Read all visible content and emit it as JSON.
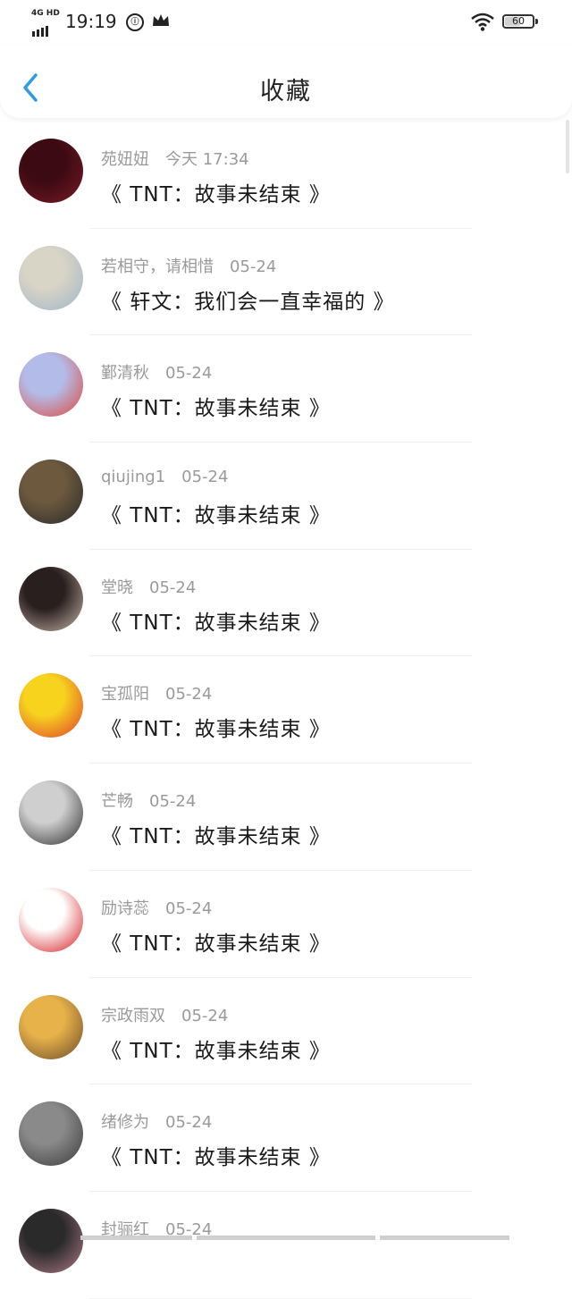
{
  "status_bar": {
    "network": "4G HD",
    "time": "19:19",
    "battery": "60",
    "battery_level": 0.6
  },
  "header": {
    "title": "收藏",
    "back_icon": "chevron-left-icon",
    "accent_color": "#2f9be4"
  },
  "items": [
    {
      "name": "苑妞妞",
      "time": "今天 17:34",
      "title": "《 TNT：故事未结束 》",
      "avatar_colors": [
        "#3b0a12",
        "#7a1a24"
      ]
    },
    {
      "name": "若相守，请相惜",
      "time": "05-24",
      "title": "《 轩文：我们会一直幸福的 》",
      "avatar_colors": [
        "#d8d4c6",
        "#9fb6c8"
      ]
    },
    {
      "name": "鄞清秋",
      "time": "05-24",
      "title": "《 TNT：故事未结束 》",
      "avatar_colors": [
        "#b3bce8",
        "#e0463c"
      ]
    },
    {
      "name": "qiujing1",
      "time": "05-24",
      "title": "《 TNT：故事未结束 》",
      "avatar_colors": [
        "#6d5a3e",
        "#2a2a2a"
      ]
    },
    {
      "name": "堂晓",
      "time": "05-24",
      "title": "《 TNT：故事未结束 》",
      "avatar_colors": [
        "#2a1f1f",
        "#c8b6a8"
      ]
    },
    {
      "name": "宝孤阳",
      "time": "05-24",
      "title": "《 TNT：故事未结束 》",
      "avatar_colors": [
        "#f7d31e",
        "#e03b2e"
      ]
    },
    {
      "name": "芒畅",
      "time": "05-24",
      "title": "《 TNT：故事未结束 》",
      "avatar_colors": [
        "#cfcfcf",
        "#2b2b2b"
      ]
    },
    {
      "name": "励诗蕊",
      "time": "05-24",
      "title": "《 TNT：故事未结束 》",
      "avatar_colors": [
        "#ffffff",
        "#d4161b"
      ]
    },
    {
      "name": "宗政雨双",
      "time": "05-24",
      "title": "《 TNT：故事未结束 》",
      "avatar_colors": [
        "#e8b24a",
        "#6a4a2a"
      ]
    },
    {
      "name": "绪修为",
      "time": "05-24",
      "title": "《 TNT：故事未结束 》",
      "avatar_colors": [
        "#8a8a8a",
        "#3a3a3a"
      ]
    },
    {
      "name": "封骊红",
      "time": "05-24",
      "title": "",
      "avatar_colors": [
        "#2a2a2a",
        "#b07a8a"
      ]
    }
  ]
}
